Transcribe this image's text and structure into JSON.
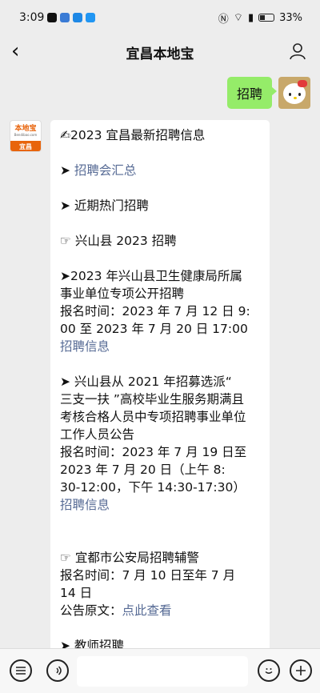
{
  "status": {
    "time": "3:09",
    "battery": "33%"
  },
  "header": {
    "title": "宜昌本地宝"
  },
  "outgoing": {
    "text": "招聘"
  },
  "bot_avatar": {
    "logo": "本地宝",
    "url": "Bendibao.com",
    "city": "宜昌"
  },
  "message": {
    "l1": "✍2023 宜昌最新招聘信息",
    "l2_prefix": "➤ ",
    "l2_link": "招聘会汇总",
    "l3": "➤ 近期热门招聘",
    "l4": "☞ 兴山县 2023 招聘",
    "l5a": "➤2023 年兴山县卫生健康局所属",
    "l5b": "事业单位专项公开招聘",
    "l5c": "报名时间：2023 年 7 月 12 日 9:",
    "l5d": "00 至 2023 年 7 月 20 日 17:00",
    "l5_link": "招聘信息",
    "l6a": "➤ 兴山县从 2021 年招募选派“",
    "l6b": "三支一扶 ”高校毕业生服务期满且",
    "l6c": "考核合格人员中专项招聘事业单位",
    "l6d": "工作人员公告",
    "l6e": "报名时间：2023 年 7 月 19 日至",
    "l6f": "2023 年 7 月 20 日（上午 8:",
    "l6g": "30-12:00，下午 14:30-17:30）",
    "l6_link": "招聘信息",
    "l7": "☞ 宜都市公安局招聘辅警",
    "l7b": "报名时间：7 月 10 日至年 7 月",
    "l7c": "14 日",
    "l7d_prefix": "公告原文：",
    "l7d_link": "点此查看",
    "l8": "➤ 教师招聘"
  },
  "colors": {
    "out_bubble": "#95ec69",
    "link": "#576b95",
    "brand": "#e8640c"
  },
  "icons": [
    "back-icon",
    "user-icon",
    "menu-icon",
    "voice-icon",
    "emoji-icon",
    "plus-icon"
  ]
}
